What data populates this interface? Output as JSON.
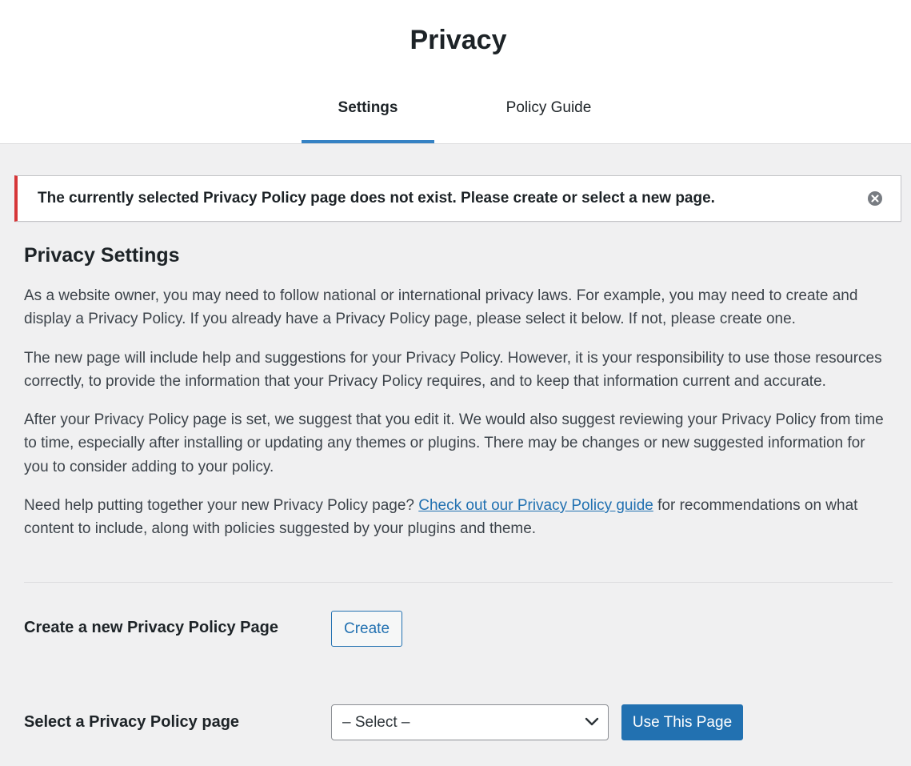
{
  "header": {
    "title": "Privacy",
    "tabs": [
      {
        "label": "Settings",
        "active": true
      },
      {
        "label": "Policy Guide",
        "active": false
      }
    ]
  },
  "notice": {
    "type": "error",
    "message": "The currently selected Privacy Policy page does not exist. Please create or select a new page.",
    "dismiss_icon": "close-circle-icon",
    "accent_color": "#d63638"
  },
  "settings": {
    "heading": "Privacy Settings",
    "paragraph1": "As a website owner, you may need to follow national or international privacy laws. For example, you may need to create and display a Privacy Policy. If you already have a Privacy Policy page, please select it below. If not, please create one.",
    "paragraph2": "The new page will include help and suggestions for your Privacy Policy. However, it is your responsibility to use those resources correctly, to provide the information that your Privacy Policy requires, and to keep that information current and accurate.",
    "paragraph3": "After your Privacy Policy page is set, we suggest that you edit it. We would also suggest reviewing your Privacy Policy from time to time, especially after installing or updating any themes or plugins. There may be changes or new suggested information for you to consider adding to your policy.",
    "paragraph4_before": "Need help putting together your new Privacy Policy page?",
    "paragraph4_link": "Check out our Privacy Policy guide",
    "paragraph4_after": "for recommendations on what content to include, along with policies suggested by your plugins and theme."
  },
  "create_row": {
    "label": "Create a new Privacy Policy Page",
    "button_label": "Create"
  },
  "select_row": {
    "label": "Select a Privacy Policy page",
    "selected_value": "– Select –",
    "button_label": "Use This Page"
  },
  "colors": {
    "accent": "#2271b1",
    "tab_indicator": "#3582c4",
    "background": "#f0f0f1"
  }
}
